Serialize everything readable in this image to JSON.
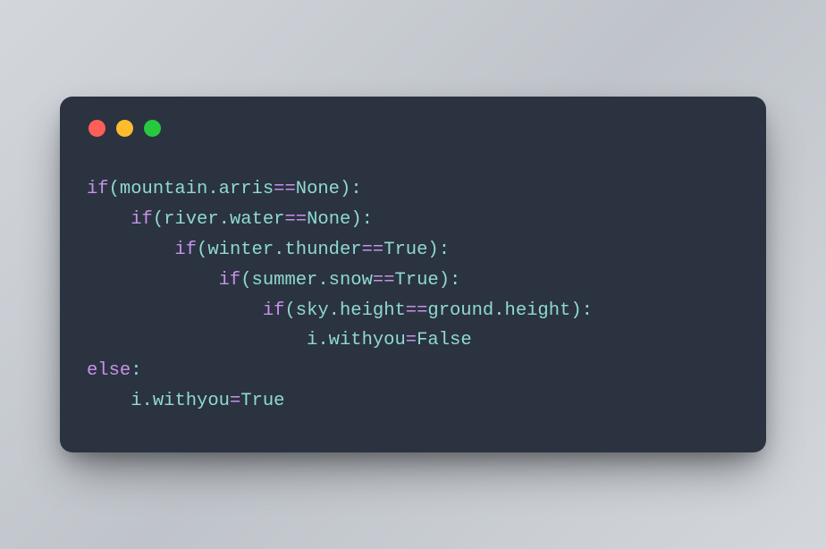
{
  "window": {
    "traffic_lights": {
      "red": "#ff5f56",
      "yellow": "#ffbd2e",
      "green": "#27c93f"
    }
  },
  "code": {
    "language": "python",
    "indent_unit": "    ",
    "lines": [
      {
        "indent": 0,
        "tokens": [
          {
            "t": "if",
            "c": "kw"
          },
          {
            "t": "(",
            "c": "punc"
          },
          {
            "t": "mountain",
            "c": "id"
          },
          {
            "t": ".",
            "c": "punc"
          },
          {
            "t": "arris",
            "c": "id"
          },
          {
            "t": "==",
            "c": "op"
          },
          {
            "t": "None",
            "c": "const"
          },
          {
            "t": ")",
            "c": "punc"
          },
          {
            "t": ":",
            "c": "punc"
          }
        ]
      },
      {
        "indent": 1,
        "tokens": [
          {
            "t": "if",
            "c": "kw"
          },
          {
            "t": "(",
            "c": "punc"
          },
          {
            "t": "river",
            "c": "id"
          },
          {
            "t": ".",
            "c": "punc"
          },
          {
            "t": "water",
            "c": "id"
          },
          {
            "t": "==",
            "c": "op"
          },
          {
            "t": "None",
            "c": "const"
          },
          {
            "t": ")",
            "c": "punc"
          },
          {
            "t": ":",
            "c": "punc"
          }
        ]
      },
      {
        "indent": 2,
        "tokens": [
          {
            "t": "if",
            "c": "kw"
          },
          {
            "t": "(",
            "c": "punc"
          },
          {
            "t": "winter",
            "c": "id"
          },
          {
            "t": ".",
            "c": "punc"
          },
          {
            "t": "thunder",
            "c": "id"
          },
          {
            "t": "==",
            "c": "op"
          },
          {
            "t": "True",
            "c": "const"
          },
          {
            "t": ")",
            "c": "punc"
          },
          {
            "t": ":",
            "c": "punc"
          }
        ]
      },
      {
        "indent": 3,
        "tokens": [
          {
            "t": "if",
            "c": "kw"
          },
          {
            "t": "(",
            "c": "punc"
          },
          {
            "t": "summer",
            "c": "id"
          },
          {
            "t": ".",
            "c": "punc"
          },
          {
            "t": "snow",
            "c": "id"
          },
          {
            "t": "==",
            "c": "op"
          },
          {
            "t": "True",
            "c": "const"
          },
          {
            "t": ")",
            "c": "punc"
          },
          {
            "t": ":",
            "c": "punc"
          }
        ]
      },
      {
        "indent": 4,
        "tokens": [
          {
            "t": "if",
            "c": "kw"
          },
          {
            "t": "(",
            "c": "punc"
          },
          {
            "t": "sky",
            "c": "id"
          },
          {
            "t": ".",
            "c": "punc"
          },
          {
            "t": "height",
            "c": "id"
          },
          {
            "t": "==",
            "c": "op"
          },
          {
            "t": "ground",
            "c": "id"
          },
          {
            "t": ".",
            "c": "punc"
          },
          {
            "t": "height",
            "c": "id"
          },
          {
            "t": ")",
            "c": "punc"
          },
          {
            "t": ":",
            "c": "punc"
          }
        ]
      },
      {
        "indent": 5,
        "tokens": [
          {
            "t": "i",
            "c": "id"
          },
          {
            "t": ".",
            "c": "punc"
          },
          {
            "t": "withyou",
            "c": "id"
          },
          {
            "t": "=",
            "c": "op"
          },
          {
            "t": "False",
            "c": "const"
          }
        ]
      },
      {
        "indent": 0,
        "tokens": [
          {
            "t": "else",
            "c": "kw"
          },
          {
            "t": ":",
            "c": "punc"
          }
        ]
      },
      {
        "indent": 1,
        "tokens": [
          {
            "t": "i",
            "c": "id"
          },
          {
            "t": ".",
            "c": "punc"
          },
          {
            "t": "withyou",
            "c": "id"
          },
          {
            "t": "=",
            "c": "op"
          },
          {
            "t": "True",
            "c": "const"
          }
        ]
      }
    ]
  }
}
